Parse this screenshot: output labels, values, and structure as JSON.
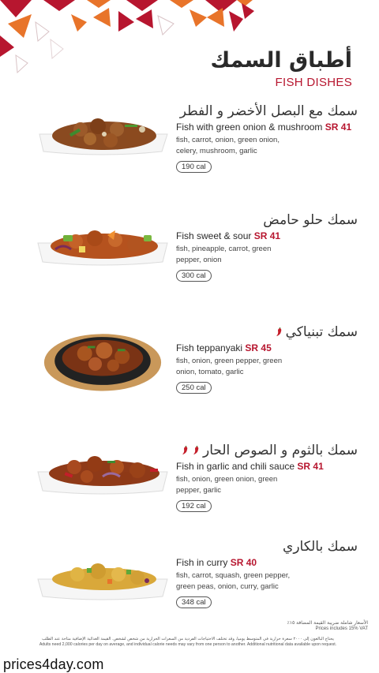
{
  "header": {
    "title_ar": "أطباق السمك",
    "title_en": "FISH DISHES"
  },
  "colors": {
    "accent": "#b7162f",
    "decor_orange": "#e8742a",
    "decor_red": "#b7162f"
  },
  "dishes": [
    {
      "name_ar": "سمك مع البصل الأخضر و الفطر",
      "name_en": "Fish with green onion & mushroom",
      "price": "SR 41",
      "ingredients": "fish, carrot, onion, green onion, celery, mushroom, garlic",
      "calories": "190 cal",
      "spicy": 0
    },
    {
      "name_ar": "سمك حلو حامض",
      "name_en": "Fish sweet & sour",
      "price": "SR 41",
      "ingredients": "fish, pineapple, carrot, green pepper, onion",
      "calories": "300 cal",
      "spicy": 0
    },
    {
      "name_ar": "سمك تبنياكي",
      "name_en": "Fish teppanyaki",
      "price": "SR 45",
      "ingredients": "fish, onion, green pepper, green onion, tomato, garlic",
      "calories": "250 cal",
      "spicy": 1
    },
    {
      "name_ar": "سمك بالثوم و الصوص الحار",
      "name_en": "Fish in garlic and chili sauce",
      "price": "SR 41",
      "ingredients": "fish, onion, green onion, green pepper, garlic",
      "calories": "192 cal",
      "spicy": 2
    },
    {
      "name_ar": "سمك بالكاري",
      "name_en": "Fish in curry",
      "price": "SR 40",
      "ingredients": "fish, carrot, squash, green pepper, green peas, onion, curry, garlic",
      "calories": "348 cal",
      "spicy": 0
    }
  ],
  "footer": {
    "vat_ar": "الأسعار شاملة ضريبة القيمة المضافة ١٥٪",
    "vat_en": "Prices includes 15% VAT",
    "note_ar": "يحتاج البالغون إلى ٢٠٠٠ سعرة حرارية في المتوسط يومياً، وقد تختلف الاحتياجات الفردية من السعرات الحرارية من شخص لشخص. القيمة الغذائية الإضافية متاحة عند الطلب",
    "note_en": "Adults need 2,000 calories per day on average, and individual calorie needs may vary from one person to another. Additional nutritional data available upon request."
  },
  "watermark": "prices4day.com"
}
